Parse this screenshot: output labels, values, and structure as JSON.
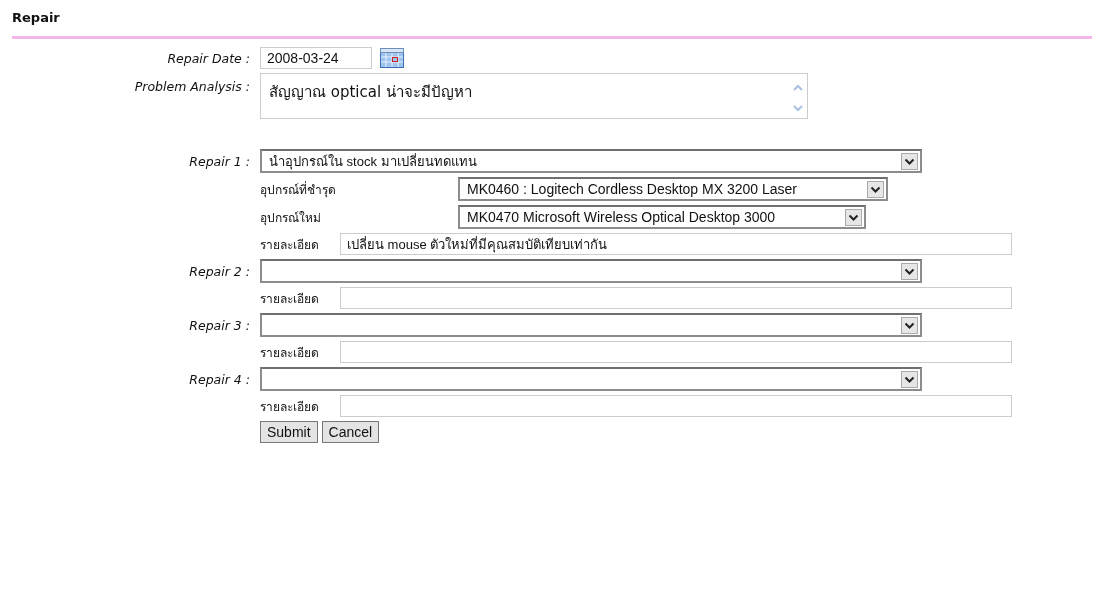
{
  "section_title": "Repair",
  "repair_date": {
    "label": "Repair Date :",
    "value": "2008-03-24"
  },
  "problem_analysis": {
    "label": "Problem Analysis :",
    "value": "สัญญาณ optical น่าจะมีปัญหา"
  },
  "repairs": [
    {
      "label": "Repair 1 :",
      "action": "นำอุปกรณ์ใน stock มาเปลี่ยนทดแทน",
      "details": [
        {
          "kind": "select",
          "label": "อุปกรณ์ที่ชำรุด",
          "value": "MK0460 : Logitech Cordless Desktop MX 3200 Laser"
        },
        {
          "kind": "select",
          "label": "อุปกรณ์ใหม่",
          "value": "MK0470 Microsoft Wireless Optical Desktop 3000"
        },
        {
          "kind": "text",
          "label": "รายละเอียด",
          "value": "เปลี่ยน mouse ตัวใหม่ที่มีคุณสมบัติเทียบเท่ากัน"
        }
      ]
    },
    {
      "label": "Repair 2 :",
      "details": [
        {
          "kind": "text",
          "label": "รายละเอียด"
        }
      ]
    },
    {
      "label": "Repair 3 :",
      "details": [
        {
          "kind": "text",
          "label": "รายละเอียด"
        }
      ]
    },
    {
      "label": "Repair 4 :",
      "details": [
        {
          "kind": "text",
          "label": "รายละเอียด"
        }
      ]
    }
  ],
  "buttons": [
    "Submit",
    "Cancel"
  ]
}
